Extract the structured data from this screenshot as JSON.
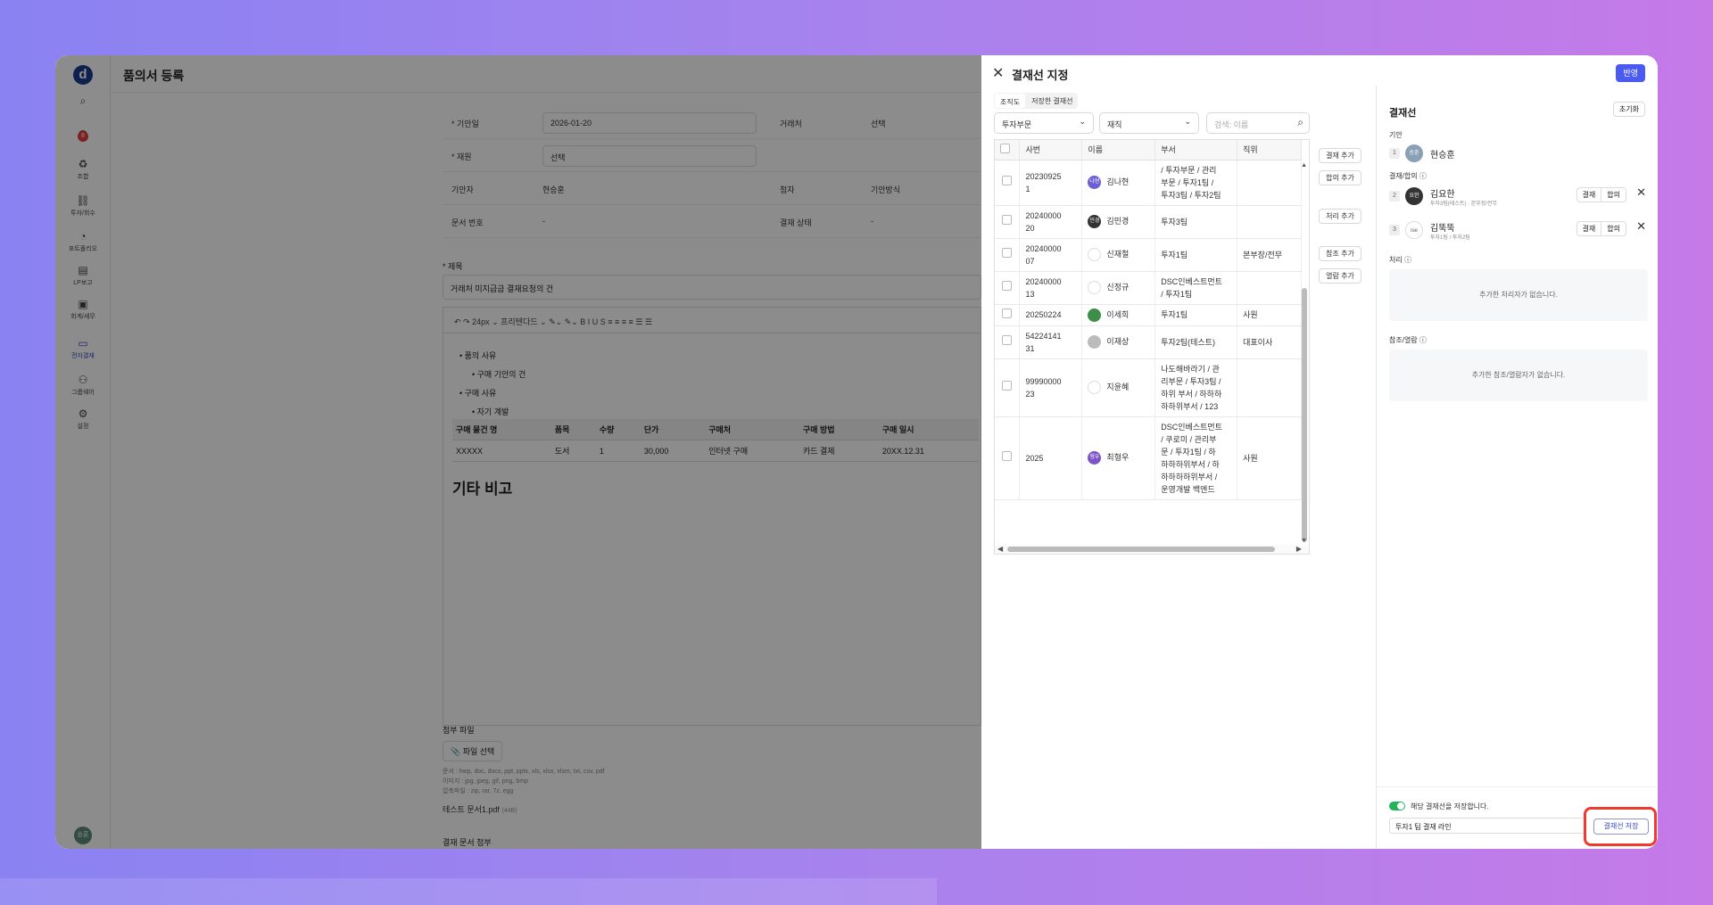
{
  "app": {
    "logo": "d",
    "page_title": "품의서 등록",
    "notif_count": "8",
    "rail": [
      {
        "icon": "search-icon",
        "glyph": "⌕",
        "label": ""
      },
      {
        "icon": "headset-icon",
        "glyph": "☊",
        "label": ""
      },
      {
        "icon": "recycle-icon",
        "glyph": "♻",
        "label": "조합"
      },
      {
        "icon": "invest-icon",
        "glyph": "⛓",
        "label": "투자/회수"
      },
      {
        "icon": "portfolio-icon",
        "glyph": "◔",
        "label": "포트폴리오"
      },
      {
        "icon": "report-icon",
        "glyph": "▤",
        "label": "LP보고"
      },
      {
        "icon": "accounting-icon",
        "glyph": "▣",
        "label": "회계/세무"
      },
      {
        "icon": "approval-icon",
        "glyph": "▭",
        "label": "전자결재"
      },
      {
        "icon": "groupware-icon",
        "glyph": "⚇",
        "label": "그룹웨어"
      },
      {
        "icon": "settings-icon",
        "glyph": "⚙",
        "label": "설정"
      }
    ],
    "avatar": "승훈"
  },
  "form": {
    "rows": [
      {
        "label": "* 기안일",
        "value": "2026-01-20",
        "label2": "거래처",
        "value2": "선택"
      },
      {
        "label": "* 재원",
        "value": "선택",
        "label2": "",
        "value2": ""
      },
      {
        "label": "기안자",
        "value": "현승훈",
        "label2": "첨자",
        "value2": "기안방식"
      },
      {
        "label": "문서 번호",
        "value": "-",
        "label2": "결재 상태",
        "value2": "-"
      }
    ],
    "subject_label": "* 제목",
    "subject_value": "거래처 미지급금 결재요청의 건",
    "toolbar": "↶  ↷    24px ⌄    프리텐다드 ⌄        ✎⌄  ✎⌄    B  I  U  S    ≡  ≡  ≡  ≡    ☰  ☰",
    "body": {
      "b1": "• 품의 사유",
      "b1a": "• 구매 기안의 건",
      "b2": "• 구매 사유",
      "b2a": "• 자기 계발",
      "headers": [
        "구매 물건 명",
        "품목",
        "수량",
        "단가",
        "구매처",
        "구매 방법",
        "구매 일시"
      ],
      "row": [
        "XXXXX",
        "도서",
        "1",
        "30,000",
        "인터넷 구매",
        "카드 결제",
        "20XX.12.31"
      ],
      "heading": "기타 비고"
    },
    "attach": {
      "label": "첨부 파일",
      "button": "📎 파일 선택",
      "hint1": "문서 : hwp, doc, docx, ppt, pptx, xls, xlsx, xlsm, txt, csv, pdf",
      "hint2": "이미지 : jpg, jpeg, gif, png, bmp",
      "hint3": "압축파일 : zip, rar, 7z, egg",
      "file": "테스트 문서1.pdf",
      "size": "(44B)",
      "section2": "결재 문서 첨부"
    }
  },
  "panel": {
    "title": "결재선 지정",
    "apply": "반영",
    "tabs": [
      "조직도",
      "저장한 결재선"
    ],
    "filter1": "투자부문",
    "filter2": "재직",
    "search_placeholder": "검색: 이름",
    "columns": [
      "사번",
      "이름",
      "부서",
      "직위"
    ],
    "rows": [
      {
        "emp": "20230925\n1",
        "name": "김나현",
        "av": "나현",
        "avc": "#6b5fd3",
        "dept": "/ 투자부문 / 관리\n부문 / 투자1팀 /\n투자3팀 / 투자2팀",
        "pos": ""
      },
      {
        "emp": "20240000\n20",
        "name": "김민경",
        "av": "민경",
        "avc": "#333333",
        "dept": "투자3팀",
        "pos": ""
      },
      {
        "emp": "20240000\n07",
        "name": "신재철",
        "av": "",
        "avc": "",
        "dept": "투자1팀",
        "pos": "본부장/전무"
      },
      {
        "emp": "20240000\n13",
        "name": "신정규",
        "av": "",
        "avc": "",
        "dept": "DSC인베스트먼트\n/ 투자1팀",
        "pos": ""
      },
      {
        "emp": "20250224",
        "name": "이세희",
        "av": "",
        "avc": "#3e8e48",
        "dept": "투자1팀",
        "pos": "사원"
      },
      {
        "emp": "54224141\n31",
        "name": "이재상",
        "av": "",
        "avc": "#bbbbbb",
        "dept": "투자2팀(테스트)",
        "pos": "대표이사"
      },
      {
        "emp": "99990000\n23",
        "name": "지윤혜",
        "av": "",
        "avc": "",
        "dept": "나도해바라기 / 관\n리부문 / 투자3팀 /\n하위 부서 / 하하하\n하하위부서 / 123",
        "pos": ""
      },
      {
        "emp": "2025",
        "name": "최형우",
        "av": "형우",
        "avc": "#7b55c8",
        "dept": "DSC인베스트먼트\n/ 쿠로미 / 관리부\n문 / 투자1팀 / 하\n하하하위부서 / 하\n하하하하위부서 /\n운영개발 백엔드",
        "pos": "사원"
      }
    ],
    "add_buttons": [
      "결재 추가",
      "합의 추가",
      "처리 추가",
      "참조 추가",
      "열람 추가"
    ],
    "line": {
      "title": "결재선",
      "reset": "초기화",
      "drafter_label": "기안",
      "drafter": {
        "num": "1",
        "name": "현승훈",
        "av": "승훈",
        "avc": "#8aa0b4"
      },
      "approve_label": "결재/합의 ⓘ",
      "approvers": [
        {
          "num": "2",
          "name": "김요한",
          "dept": "투자3팀(테스트) · 본부장/전무",
          "av": "요한",
          "avc": "#333333",
          "seg1": "결재",
          "seg2": "합의"
        },
        {
          "num": "3",
          "name": "김뚝뚝",
          "dept": "투자1팀 / 투자2팀",
          "av": "ise",
          "avc": "#ffffff",
          "seg1": "결재",
          "seg2": "합의"
        }
      ],
      "process_label": "처리 ⓘ",
      "process_empty": "추가한 처리자가 없습니다.",
      "ref_label": "참조/열람 ⓘ",
      "ref_empty": "추가한 참조/열람자가 없습니다.",
      "save_toggle": "해당 결재선을 저장합니다.",
      "save_name": "투자1 팀 결재 라인",
      "save_button": "결재선 저장"
    }
  }
}
